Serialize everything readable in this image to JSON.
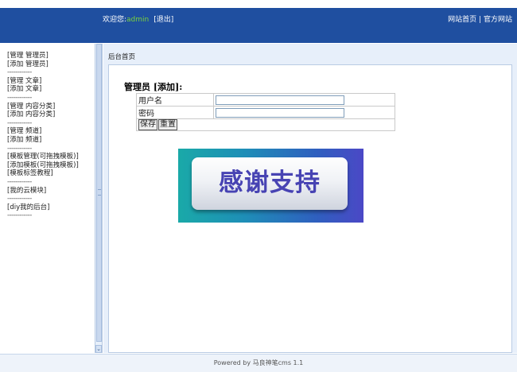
{
  "header": {
    "welcome_label": "欢迎您:",
    "username": "admin",
    "logout_label": "[退出]",
    "site_home_link": "网站首页",
    "separator": "|",
    "official_site_link": "官方网站"
  },
  "sidebar": {
    "items": [
      "[管理 管理员]",
      "[添加 管理员]",
      "------------",
      "[管理 文章]",
      "[添加 文章]",
      "------------",
      "[管理 内容分类]",
      "[添加 内容分类]",
      "------------",
      "[管理 频道]",
      "[添加 频道]",
      "------------",
      "[模板管理(可拖拽模板)]",
      "[添加模板(可拖拽模板)]",
      "[模板标签教程]",
      "------------",
      "[我的云模块]",
      "------------",
      "[diy我的后台]",
      "------------"
    ]
  },
  "breadcrumb": "后台首页",
  "form": {
    "title": "管理员 [添加]:",
    "username_label": "用户名",
    "username_value": "",
    "password_label": "密码",
    "password_value": "",
    "save_label": "保存",
    "reset_label": "重置"
  },
  "banner": {
    "text": "感谢支持"
  },
  "footer": {
    "text": "Powered by 马良神笔cms 1.1"
  },
  "colors": {
    "header_bg": "#1f4fa0",
    "username": "#7bd23a",
    "main_bg": "#e7effa"
  }
}
